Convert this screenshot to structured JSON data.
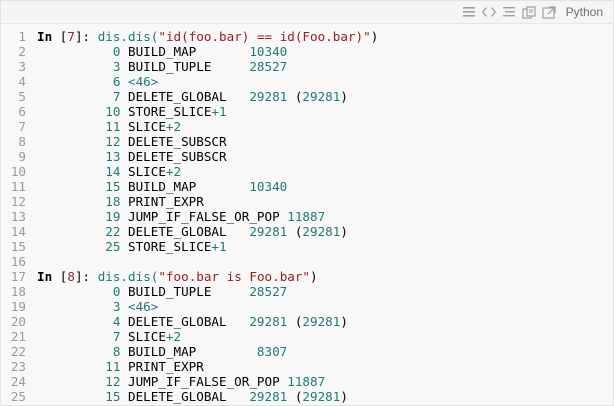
{
  "toolbar": {
    "icons": [
      "menu-icon",
      "view-source-icon",
      "lines-icon",
      "copy-icon",
      "popup-icon"
    ],
    "language": "Python"
  },
  "colors": {
    "background": "#f8f8f8",
    "line_numbers": "#9a9a9a",
    "number_teal": "#1e7a78",
    "string_red": "#9a1b1b",
    "prompt_black": "#000000"
  },
  "lines": [
    [
      {
        "t": "In ",
        "c": "kw"
      },
      {
        "t": "[",
        "c": "pl"
      },
      {
        "t": "7",
        "c": "br"
      },
      {
        "t": "]",
        "c": "pl"
      },
      {
        "t": ": ",
        "c": "pl"
      },
      {
        "t": "dis.dis(",
        "c": "fn"
      },
      {
        "t": "\"id(foo.bar) == id(Foo.bar)\"",
        "c": "str"
      },
      {
        "t": ")",
        "c": "pl"
      }
    ],
    [
      {
        "t": "          ",
        "c": "pl"
      },
      {
        "t": "0",
        "c": "num"
      },
      {
        "t": " BUILD_MAP       ",
        "c": "pl"
      },
      {
        "t": "10340",
        "c": "num"
      }
    ],
    [
      {
        "t": "          ",
        "c": "pl"
      },
      {
        "t": "3",
        "c": "num"
      },
      {
        "t": " BUILD_TUPLE     ",
        "c": "pl"
      },
      {
        "t": "28527",
        "c": "num"
      }
    ],
    [
      {
        "t": "          ",
        "c": "pl"
      },
      {
        "t": "6",
        "c": "num"
      },
      {
        "t": " ",
        "c": "pl"
      },
      {
        "t": "<46>",
        "c": "num"
      }
    ],
    [
      {
        "t": "          ",
        "c": "pl"
      },
      {
        "t": "7",
        "c": "num"
      },
      {
        "t": " DELETE_GLOBAL   ",
        "c": "pl"
      },
      {
        "t": "29281",
        "c": "num"
      },
      {
        "t": " (",
        "c": "pl"
      },
      {
        "t": "29281",
        "c": "num"
      },
      {
        "t": ")",
        "c": "pl"
      }
    ],
    [
      {
        "t": "         ",
        "c": "pl"
      },
      {
        "t": "10",
        "c": "num"
      },
      {
        "t": " STORE_SLICE",
        "c": "pl"
      },
      {
        "t": "+1",
        "c": "num"
      }
    ],
    [
      {
        "t": "         ",
        "c": "pl"
      },
      {
        "t": "11",
        "c": "num"
      },
      {
        "t": " SLICE",
        "c": "pl"
      },
      {
        "t": "+2",
        "c": "num"
      }
    ],
    [
      {
        "t": "         ",
        "c": "pl"
      },
      {
        "t": "12",
        "c": "num"
      },
      {
        "t": " DELETE_SUBSCR",
        "c": "pl"
      }
    ],
    [
      {
        "t": "         ",
        "c": "pl"
      },
      {
        "t": "13",
        "c": "num"
      },
      {
        "t": " DELETE_SUBSCR",
        "c": "pl"
      }
    ],
    [
      {
        "t": "         ",
        "c": "pl"
      },
      {
        "t": "14",
        "c": "num"
      },
      {
        "t": " SLICE",
        "c": "pl"
      },
      {
        "t": "+2",
        "c": "num"
      }
    ],
    [
      {
        "t": "         ",
        "c": "pl"
      },
      {
        "t": "15",
        "c": "num"
      },
      {
        "t": " BUILD_MAP       ",
        "c": "pl"
      },
      {
        "t": "10340",
        "c": "num"
      }
    ],
    [
      {
        "t": "         ",
        "c": "pl"
      },
      {
        "t": "18",
        "c": "num"
      },
      {
        "t": " PRINT_EXPR",
        "c": "pl"
      }
    ],
    [
      {
        "t": "         ",
        "c": "pl"
      },
      {
        "t": "19",
        "c": "num"
      },
      {
        "t": " JUMP_IF_FALSE_OR_POP ",
        "c": "pl"
      },
      {
        "t": "11887",
        "c": "num"
      }
    ],
    [
      {
        "t": "         ",
        "c": "pl"
      },
      {
        "t": "22",
        "c": "num"
      },
      {
        "t": " DELETE_GLOBAL   ",
        "c": "pl"
      },
      {
        "t": "29281",
        "c": "num"
      },
      {
        "t": " (",
        "c": "pl"
      },
      {
        "t": "29281",
        "c": "num"
      },
      {
        "t": ")",
        "c": "pl"
      }
    ],
    [
      {
        "t": "         ",
        "c": "pl"
      },
      {
        "t": "25",
        "c": "num"
      },
      {
        "t": " STORE_SLICE",
        "c": "pl"
      },
      {
        "t": "+1",
        "c": "num"
      }
    ],
    [],
    [
      {
        "t": "In ",
        "c": "kw"
      },
      {
        "t": "[",
        "c": "pl"
      },
      {
        "t": "8",
        "c": "br"
      },
      {
        "t": "]",
        "c": "pl"
      },
      {
        "t": ": ",
        "c": "pl"
      },
      {
        "t": "dis.dis(",
        "c": "fn"
      },
      {
        "t": "\"foo.bar is Foo.bar\"",
        "c": "str"
      },
      {
        "t": ")",
        "c": "pl"
      }
    ],
    [
      {
        "t": "          ",
        "c": "pl"
      },
      {
        "t": "0",
        "c": "num"
      },
      {
        "t": " BUILD_TUPLE     ",
        "c": "pl"
      },
      {
        "t": "28527",
        "c": "num"
      }
    ],
    [
      {
        "t": "          ",
        "c": "pl"
      },
      {
        "t": "3",
        "c": "num"
      },
      {
        "t": " ",
        "c": "pl"
      },
      {
        "t": "<46>",
        "c": "num"
      }
    ],
    [
      {
        "t": "          ",
        "c": "pl"
      },
      {
        "t": "4",
        "c": "num"
      },
      {
        "t": " DELETE_GLOBAL   ",
        "c": "pl"
      },
      {
        "t": "29281",
        "c": "num"
      },
      {
        "t": " (",
        "c": "pl"
      },
      {
        "t": "29281",
        "c": "num"
      },
      {
        "t": ")",
        "c": "pl"
      }
    ],
    [
      {
        "t": "          ",
        "c": "pl"
      },
      {
        "t": "7",
        "c": "num"
      },
      {
        "t": " SLICE",
        "c": "pl"
      },
      {
        "t": "+2",
        "c": "num"
      }
    ],
    [
      {
        "t": "          ",
        "c": "pl"
      },
      {
        "t": "8",
        "c": "num"
      },
      {
        "t": " BUILD_MAP        ",
        "c": "pl"
      },
      {
        "t": "8307",
        "c": "num"
      }
    ],
    [
      {
        "t": "         ",
        "c": "pl"
      },
      {
        "t": "11",
        "c": "num"
      },
      {
        "t": " PRINT_EXPR",
        "c": "pl"
      }
    ],
    [
      {
        "t": "         ",
        "c": "pl"
      },
      {
        "t": "12",
        "c": "num"
      },
      {
        "t": " JUMP_IF_FALSE_OR_POP ",
        "c": "pl"
      },
      {
        "t": "11887",
        "c": "num"
      }
    ],
    [
      {
        "t": "         ",
        "c": "pl"
      },
      {
        "t": "15",
        "c": "num"
      },
      {
        "t": " DELETE_GLOBAL   ",
        "c": "pl"
      },
      {
        "t": "29281",
        "c": "num"
      },
      {
        "t": " (",
        "c": "pl"
      },
      {
        "t": "29281",
        "c": "num"
      },
      {
        "t": ")",
        "c": "pl"
      }
    ]
  ]
}
